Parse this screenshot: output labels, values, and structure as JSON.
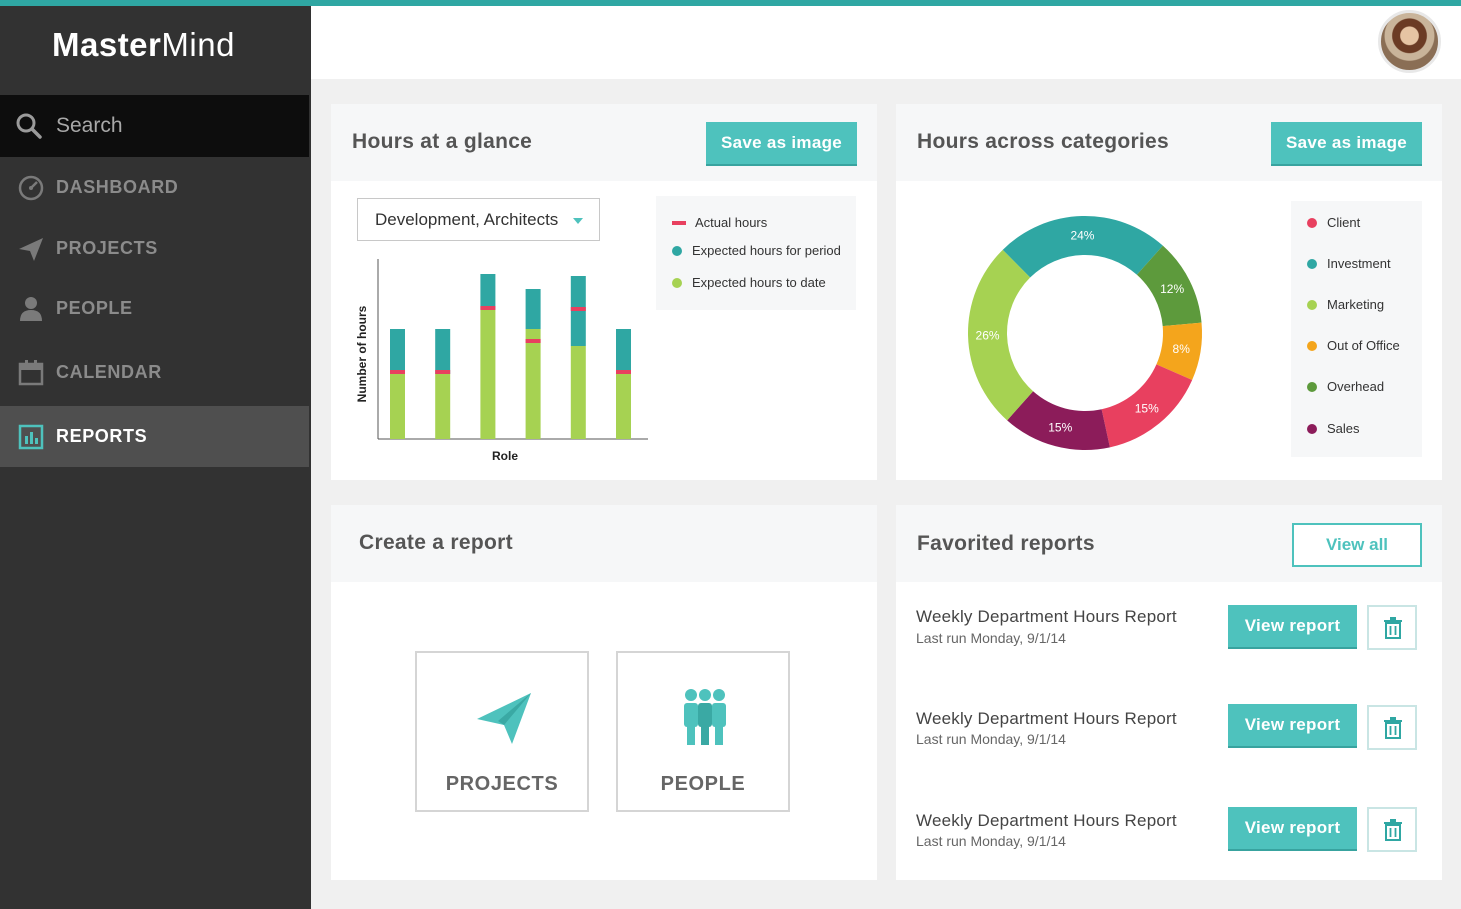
{
  "app": {
    "logo_bold": "Master",
    "logo_light": "Mind"
  },
  "sidebar": {
    "search_label": "Search",
    "items": [
      {
        "label": "DASHBOARD",
        "icon": "gauge-icon",
        "active": false
      },
      {
        "label": "PROJECTS",
        "icon": "paper-plane-icon",
        "active": false
      },
      {
        "label": "PEOPLE",
        "icon": "person-icon",
        "active": false
      },
      {
        "label": "CALENDAR",
        "icon": "calendar-icon",
        "active": false
      },
      {
        "label": "REPORTS",
        "icon": "bar-chart-icon",
        "active": true
      }
    ]
  },
  "hours_glance": {
    "title": "Hours at a glance",
    "save_label": "Save as image",
    "filter_value": "Development, Architects",
    "legend": [
      "Actual hours",
      "Expected hours for period",
      "Expected hours to date"
    ],
    "ylabel": "Number of hours",
    "xlabel": "Role"
  },
  "hours_categories": {
    "title": "Hours across categories",
    "save_label": "Save as image",
    "legend": [
      "Client",
      "Investment",
      "Marketing",
      "Out of Office",
      "Overhead",
      "Sales"
    ]
  },
  "create_report": {
    "title": "Create a report",
    "tiles": [
      "PROJECTS",
      "PEOPLE"
    ]
  },
  "favorited": {
    "title": "Favorited reports",
    "view_all_label": "View all",
    "view_report_label": "View report",
    "items": [
      {
        "name": "Weekly Department Hours Report",
        "last_run": "Last run Monday, 9/1/14"
      },
      {
        "name": "Weekly Department Hours Report",
        "last_run": "Last run Monday, 9/1/14"
      },
      {
        "name": "Weekly Department Hours Report",
        "last_run": "Last run Monday, 9/1/14"
      }
    ]
  },
  "colors": {
    "teal": "#2fa7a3",
    "green": "#a6d252",
    "red": "#e8405f",
    "orange": "#f4a51c",
    "dark_green": "#5d9a3c",
    "purple": "#8c1c5a"
  },
  "chart_data": [
    {
      "type": "bar",
      "title": "Hours at a glance",
      "xlabel": "Role",
      "ylabel": "Number of hours",
      "categories": [
        "",
        "",
        "",
        "",
        "",
        ""
      ],
      "series": [
        {
          "name": "Expected hours to date",
          "values": [
            65,
            65,
            130,
            110,
            93,
            65
          ]
        },
        {
          "name": "Expected hours for period",
          "values": [
            110,
            110,
            165,
            150,
            163,
            110
          ]
        },
        {
          "name": "Actual hours",
          "values": [
            67,
            67,
            131,
            98,
            130,
            67
          ]
        }
      ],
      "ylim": [
        0,
        180
      ]
    },
    {
      "type": "pie",
      "title": "Hours across categories",
      "labels": [
        "Investment",
        "Overhead",
        "Out of Office",
        "Client",
        "Sales",
        "Marketing"
      ],
      "values": [
        24,
        12,
        8,
        15,
        15,
        26
      ],
      "colors": [
        "#2fa7a3",
        "#5d9a3c",
        "#f4a51c",
        "#e8405f",
        "#8c1c5a",
        "#a6d252"
      ]
    }
  ]
}
